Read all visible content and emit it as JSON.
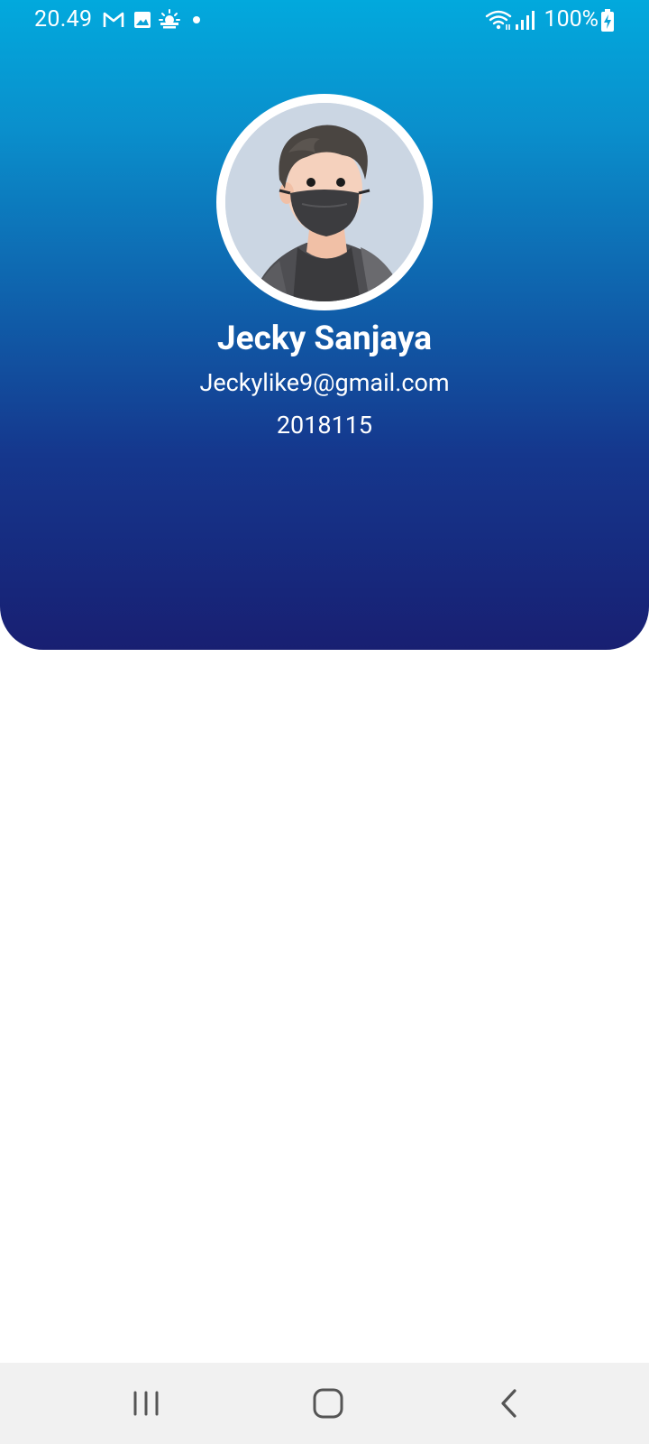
{
  "status_bar": {
    "time": "20.49",
    "battery": "100%",
    "icons": [
      "gmail-icon",
      "gallery-icon",
      "weather-icon",
      "notification-dot-icon",
      "wifi-icon",
      "signal-icon",
      "battery-charging-icon"
    ]
  },
  "profile": {
    "name": "Jecky Sanjaya",
    "email": "Jeckylike9@gmail.com",
    "id": "2018115",
    "avatar_icon": "avatar-illustration-masked-person"
  },
  "nav_bar": {
    "buttons": [
      "recent-apps-button",
      "home-button",
      "back-button"
    ]
  },
  "colors": {
    "gradient_top": "#02a9dd",
    "gradient_bottom": "#181f72",
    "nav_bg": "#f1f1f1"
  }
}
